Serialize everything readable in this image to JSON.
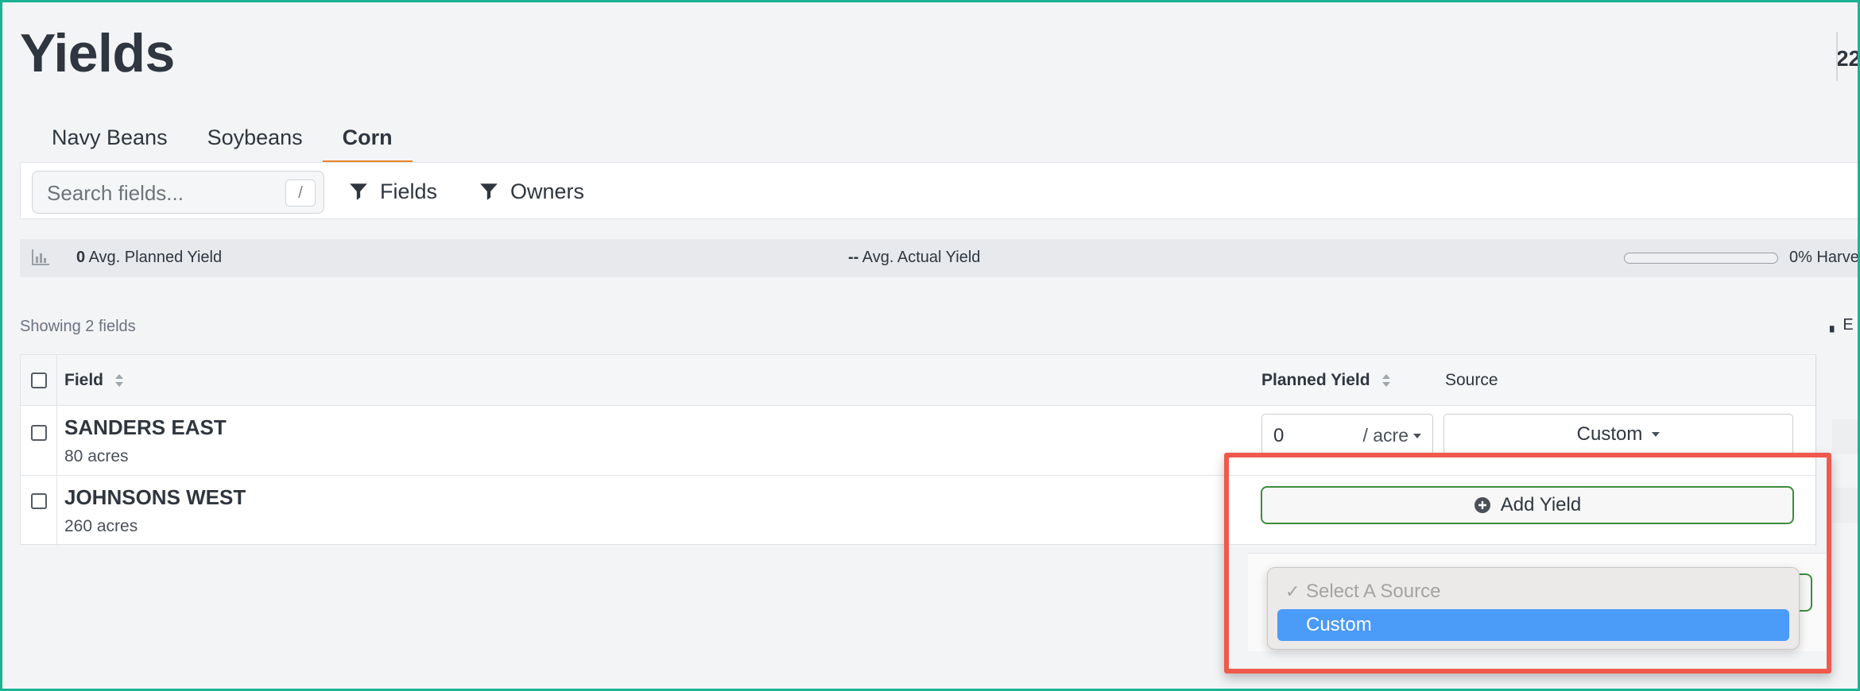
{
  "page": {
    "title": "Yields",
    "top_right_clipped": "22"
  },
  "tabs": [
    {
      "label": "Navy Beans",
      "active": false
    },
    {
      "label": "Soybeans",
      "active": false
    },
    {
      "label": "Corn",
      "active": true
    }
  ],
  "filters": {
    "search_placeholder": "Search fields...",
    "search_shortcut": "/",
    "fields_label": "Fields",
    "owners_label": "Owners"
  },
  "stats": {
    "avg_planned_value": "0",
    "avg_planned_label": "Avg. Planned Yield",
    "avg_actual_value": "--",
    "avg_actual_label": "Avg. Actual Yield",
    "harvest_percent": 0,
    "harvest_label": "0% Harve"
  },
  "list": {
    "showing": "Showing 2 fields",
    "export_clipped": "E"
  },
  "table": {
    "columns": {
      "field": "Field",
      "planned_yield": "Planned Yield",
      "source": "Source"
    },
    "rows": [
      {
        "name": "SANDERS EAST",
        "acres": "80 acres",
        "planned_value": "0",
        "unit": "/ acre",
        "source": "Custom"
      },
      {
        "name": "JOHNSONS WEST",
        "acres": "260 acres",
        "add_yield_label": "Add Yield"
      }
    ]
  },
  "source_dropdown": {
    "options": [
      {
        "label": "Select A Source",
        "disabled": true,
        "checked": true
      },
      {
        "label": "Custom",
        "disabled": false,
        "highlighted": true
      }
    ]
  },
  "colors": {
    "accent": "#e8862a",
    "highlight_box": "#ef5a4c",
    "add_border": "#3b8d3b",
    "select_blue": "#4b9bf8",
    "frame": "#19b394"
  }
}
